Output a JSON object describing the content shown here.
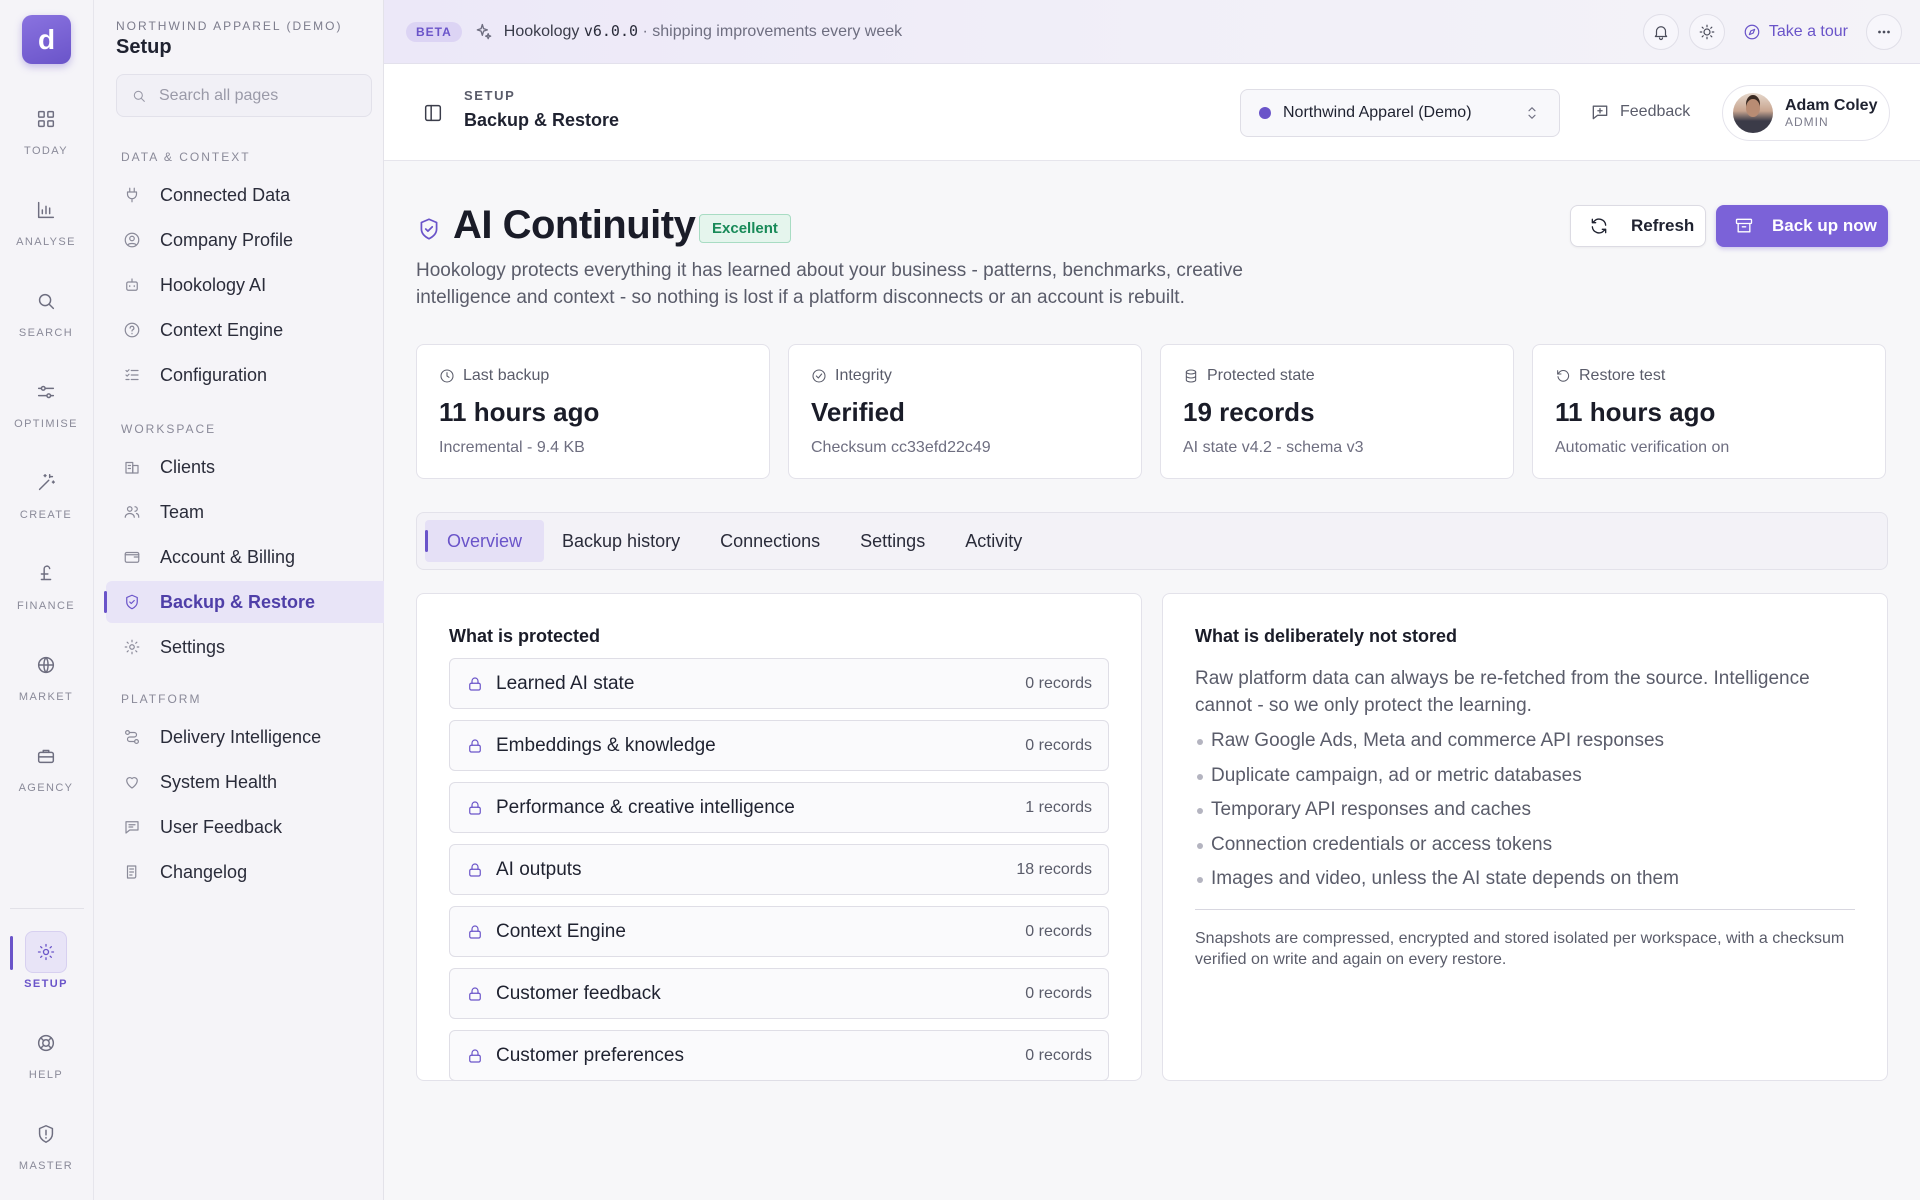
{
  "rail": {
    "logo_glyph": "d",
    "items": [
      {
        "label": "TODAY",
        "icon": "grid-icon"
      },
      {
        "label": "ANALYSE",
        "icon": "bar-chart-icon"
      },
      {
        "label": "SEARCH",
        "icon": "search-icon"
      },
      {
        "label": "OPTIMISE",
        "icon": "sliders-icon"
      },
      {
        "label": "CREATE",
        "icon": "magic-wand-icon"
      },
      {
        "label": "FINANCE",
        "icon": "pound-icon"
      },
      {
        "label": "MARKET",
        "icon": "globe-icon"
      },
      {
        "label": "AGENCY",
        "icon": "briefcase-icon"
      },
      {
        "label": "SETUP",
        "icon": "gear-icon"
      },
      {
        "label": "HELP",
        "icon": "lifebuoy-icon"
      },
      {
        "label": "MASTER",
        "icon": "shield-alert-icon"
      }
    ]
  },
  "sidebar": {
    "org": "NORTHWIND APPAREL (DEMO)",
    "title": "Setup",
    "search_placeholder": "Search all pages",
    "sections": [
      {
        "label": "DATA & CONTEXT",
        "items": [
          "Connected Data",
          "Company Profile",
          "Hookology AI",
          "Context Engine",
          "Configuration"
        ]
      },
      {
        "label": "WORKSPACE",
        "items": [
          "Clients",
          "Team",
          "Account & Billing",
          "Backup & Restore",
          "Settings"
        ]
      },
      {
        "label": "PLATFORM",
        "items": [
          "Delivery Intelligence",
          "System Health",
          "User Feedback",
          "Changelog"
        ]
      }
    ],
    "active_item": "Backup & Restore"
  },
  "beta": {
    "badge": "BETA",
    "product": "Hookology",
    "version": "v6.0.0",
    "tagline": "· shipping improvements every week",
    "tour": "Take a tour"
  },
  "header": {
    "crumb": "SETUP",
    "title": "Backup & Restore",
    "workspace": "Northwind Apparel (Demo)",
    "feedback": "Feedback",
    "user_name": "Adam Coley",
    "user_role": "ADMIN"
  },
  "page": {
    "title": "AI Continuity",
    "status": "Excellent",
    "lead": "Hookology protects everything it has learned about your business - patterns, benchmarks, creative intelligence and context - so nothing is lost if a platform disconnects or an account is rebuilt.",
    "refresh": "Refresh",
    "backup": "Back up now"
  },
  "stats": [
    {
      "label": "Last backup",
      "value": "11 hours ago",
      "sub": "Incremental - 9.4 KB",
      "icon": "clock-icon"
    },
    {
      "label": "Integrity",
      "value": "Verified",
      "sub": "Checksum cc33efd22c49",
      "icon": "check-circle-icon"
    },
    {
      "label": "Protected state",
      "value": "19 records",
      "sub": "AI state v4.2 - schema v3",
      "icon": "database-icon"
    },
    {
      "label": "Restore test",
      "value": "11 hours ago",
      "sub": "Automatic verification on",
      "icon": "rotate-ccw-icon"
    }
  ],
  "tabs": [
    "Overview",
    "Backup history",
    "Connections",
    "Settings",
    "Activity"
  ],
  "protected": {
    "title": "What is protected",
    "rows": [
      {
        "name": "Learned AI state",
        "count": "0 records"
      },
      {
        "name": "Embeddings & knowledge",
        "count": "0 records"
      },
      {
        "name": "Performance & creative intelligence",
        "count": "1 records"
      },
      {
        "name": "AI outputs",
        "count": "18 records"
      },
      {
        "name": "Context Engine",
        "count": "0 records"
      },
      {
        "name": "Customer feedback",
        "count": "0 records"
      },
      {
        "name": "Customer preferences",
        "count": "0 records"
      }
    ]
  },
  "not_stored": {
    "title": "What is deliberately not stored",
    "lead": "Raw platform data can always be re-fetched from the source. Intelligence cannot - so we only protect the learning.",
    "bullets": [
      "Raw Google Ads, Meta and commerce API responses",
      "Duplicate campaign, ad or metric databases",
      "Temporary API responses and caches",
      "Connection credentials or access tokens",
      "Images and video, unless the AI state depends on them"
    ],
    "note": "Snapshots are compressed, encrypted and stored isolated per workspace, with a checksum verified on write and again on every restore."
  },
  "colors": {
    "accent": "#6a54c9",
    "success": "#188a58"
  }
}
